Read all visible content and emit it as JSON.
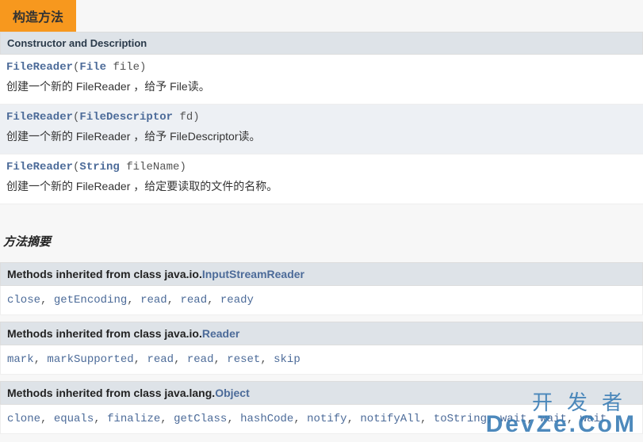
{
  "tab": {
    "label": "构造方法"
  },
  "constructor_section": {
    "header": "Constructor and Description",
    "rows": [
      {
        "cls": "FileReader",
        "type": "File",
        "param": "file",
        "desc": "创建一个新的 FileReader ，给予 File读。"
      },
      {
        "cls": "FileReader",
        "type": "FileDescriptor",
        "param": "fd",
        "desc": "创建一个新的 FileReader ，给予 FileDescriptor读。"
      },
      {
        "cls": "FileReader",
        "type": "String",
        "param": "fileName",
        "desc": "创建一个新的 FileReader ，给定要读取的文件的名称。"
      }
    ]
  },
  "method_summary_title": "方法摘要",
  "inherited": [
    {
      "prefix": "Methods inherited from class java.io.",
      "parent": "InputStreamReader",
      "methods": [
        "close",
        "getEncoding",
        "read",
        "read",
        "ready"
      ]
    },
    {
      "prefix": "Methods inherited from class java.io.",
      "parent": "Reader",
      "methods": [
        "mark",
        "markSupported",
        "read",
        "read",
        "reset",
        "skip"
      ]
    },
    {
      "prefix": "Methods inherited from class java.lang.",
      "parent": "Object",
      "methods": [
        "clone",
        "equals",
        "finalize",
        "getClass",
        "hashCode",
        "notify",
        "notifyAll",
        "toString",
        "wait",
        "wait",
        "wait"
      ]
    }
  ],
  "watermark": {
    "top": "开发者",
    "bottom": "DevZe.CoM"
  }
}
